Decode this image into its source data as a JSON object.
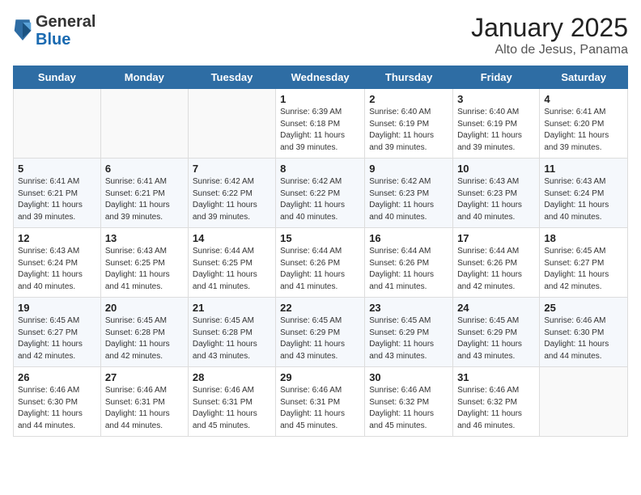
{
  "header": {
    "logo_general": "General",
    "logo_blue": "Blue",
    "title": "January 2025",
    "subtitle": "Alto de Jesus, Panama"
  },
  "calendar": {
    "days_of_week": [
      "Sunday",
      "Monday",
      "Tuesday",
      "Wednesday",
      "Thursday",
      "Friday",
      "Saturday"
    ],
    "weeks": [
      [
        {
          "day": "",
          "info": ""
        },
        {
          "day": "",
          "info": ""
        },
        {
          "day": "",
          "info": ""
        },
        {
          "day": "1",
          "info": "Sunrise: 6:39 AM\nSunset: 6:18 PM\nDaylight: 11 hours and 39 minutes."
        },
        {
          "day": "2",
          "info": "Sunrise: 6:40 AM\nSunset: 6:19 PM\nDaylight: 11 hours and 39 minutes."
        },
        {
          "day": "3",
          "info": "Sunrise: 6:40 AM\nSunset: 6:19 PM\nDaylight: 11 hours and 39 minutes."
        },
        {
          "day": "4",
          "info": "Sunrise: 6:41 AM\nSunset: 6:20 PM\nDaylight: 11 hours and 39 minutes."
        }
      ],
      [
        {
          "day": "5",
          "info": "Sunrise: 6:41 AM\nSunset: 6:21 PM\nDaylight: 11 hours and 39 minutes."
        },
        {
          "day": "6",
          "info": "Sunrise: 6:41 AM\nSunset: 6:21 PM\nDaylight: 11 hours and 39 minutes."
        },
        {
          "day": "7",
          "info": "Sunrise: 6:42 AM\nSunset: 6:22 PM\nDaylight: 11 hours and 39 minutes."
        },
        {
          "day": "8",
          "info": "Sunrise: 6:42 AM\nSunset: 6:22 PM\nDaylight: 11 hours and 40 minutes."
        },
        {
          "day": "9",
          "info": "Sunrise: 6:42 AM\nSunset: 6:23 PM\nDaylight: 11 hours and 40 minutes."
        },
        {
          "day": "10",
          "info": "Sunrise: 6:43 AM\nSunset: 6:23 PM\nDaylight: 11 hours and 40 minutes."
        },
        {
          "day": "11",
          "info": "Sunrise: 6:43 AM\nSunset: 6:24 PM\nDaylight: 11 hours and 40 minutes."
        }
      ],
      [
        {
          "day": "12",
          "info": "Sunrise: 6:43 AM\nSunset: 6:24 PM\nDaylight: 11 hours and 40 minutes."
        },
        {
          "day": "13",
          "info": "Sunrise: 6:43 AM\nSunset: 6:25 PM\nDaylight: 11 hours and 41 minutes."
        },
        {
          "day": "14",
          "info": "Sunrise: 6:44 AM\nSunset: 6:25 PM\nDaylight: 11 hours and 41 minutes."
        },
        {
          "day": "15",
          "info": "Sunrise: 6:44 AM\nSunset: 6:26 PM\nDaylight: 11 hours and 41 minutes."
        },
        {
          "day": "16",
          "info": "Sunrise: 6:44 AM\nSunset: 6:26 PM\nDaylight: 11 hours and 41 minutes."
        },
        {
          "day": "17",
          "info": "Sunrise: 6:44 AM\nSunset: 6:26 PM\nDaylight: 11 hours and 42 minutes."
        },
        {
          "day": "18",
          "info": "Sunrise: 6:45 AM\nSunset: 6:27 PM\nDaylight: 11 hours and 42 minutes."
        }
      ],
      [
        {
          "day": "19",
          "info": "Sunrise: 6:45 AM\nSunset: 6:27 PM\nDaylight: 11 hours and 42 minutes."
        },
        {
          "day": "20",
          "info": "Sunrise: 6:45 AM\nSunset: 6:28 PM\nDaylight: 11 hours and 42 minutes."
        },
        {
          "day": "21",
          "info": "Sunrise: 6:45 AM\nSunset: 6:28 PM\nDaylight: 11 hours and 43 minutes."
        },
        {
          "day": "22",
          "info": "Sunrise: 6:45 AM\nSunset: 6:29 PM\nDaylight: 11 hours and 43 minutes."
        },
        {
          "day": "23",
          "info": "Sunrise: 6:45 AM\nSunset: 6:29 PM\nDaylight: 11 hours and 43 minutes."
        },
        {
          "day": "24",
          "info": "Sunrise: 6:45 AM\nSunset: 6:29 PM\nDaylight: 11 hours and 43 minutes."
        },
        {
          "day": "25",
          "info": "Sunrise: 6:46 AM\nSunset: 6:30 PM\nDaylight: 11 hours and 44 minutes."
        }
      ],
      [
        {
          "day": "26",
          "info": "Sunrise: 6:46 AM\nSunset: 6:30 PM\nDaylight: 11 hours and 44 minutes."
        },
        {
          "day": "27",
          "info": "Sunrise: 6:46 AM\nSunset: 6:31 PM\nDaylight: 11 hours and 44 minutes."
        },
        {
          "day": "28",
          "info": "Sunrise: 6:46 AM\nSunset: 6:31 PM\nDaylight: 11 hours and 45 minutes."
        },
        {
          "day": "29",
          "info": "Sunrise: 6:46 AM\nSunset: 6:31 PM\nDaylight: 11 hours and 45 minutes."
        },
        {
          "day": "30",
          "info": "Sunrise: 6:46 AM\nSunset: 6:32 PM\nDaylight: 11 hours and 45 minutes."
        },
        {
          "day": "31",
          "info": "Sunrise: 6:46 AM\nSunset: 6:32 PM\nDaylight: 11 hours and 46 minutes."
        },
        {
          "day": "",
          "info": ""
        }
      ]
    ]
  }
}
